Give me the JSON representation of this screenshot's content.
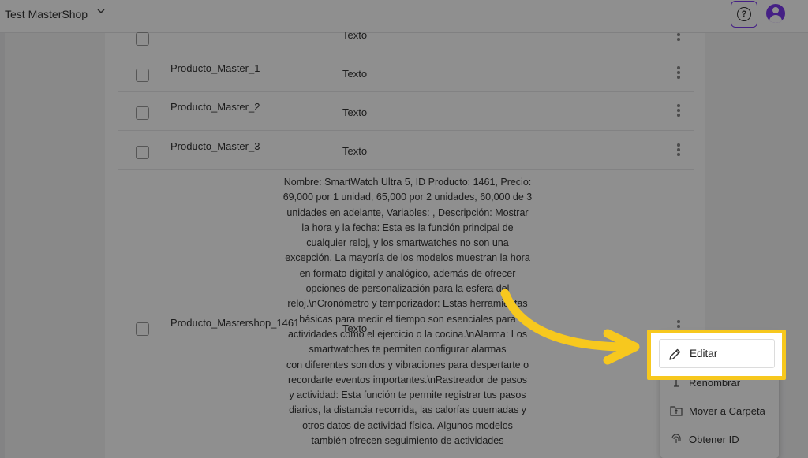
{
  "topbar": {
    "shop_name": "Test MasterShop",
    "chevron_glyph": "⌄",
    "help_glyph": "?"
  },
  "rows": [
    {
      "name": "",
      "type": "Texto"
    },
    {
      "name": "Producto_Master_1",
      "type": "Texto"
    },
    {
      "name": "Producto_Master_2",
      "type": "Texto"
    },
    {
      "name": "Producto_Master_3",
      "type": "Texto"
    },
    {
      "name": "Producto_Mastershop_1461",
      "type": "Texto"
    }
  ],
  "description_lines": [
    "Nombre: SmartWatch Ultra 5, ID Producto: 1461, Precio:",
    "69,000 por 1 unidad, 65,000 por 2 unidades, 60,000 de 3",
    "unidades en adelante, Variables: , Descripción: Mostrar",
    "la hora y la fecha: Esta es la función principal de",
    "cualquier reloj, y los smartwatches no son una",
    "excepción. La mayoría de los modelos muestran la hora",
    "en formato digital y analógico, además de ofrecer",
    "opciones de personalización para la esfera del",
    "reloj.\\nCronómetro y temporizador: Estas herramientas",
    "básicas para medir el tiempo son esenciales para",
    "actividades como el ejercicio o la cocina.\\nAlarma: Los",
    "smartwatches te permiten configurar alarmas",
    "con diferentes sonidos y vibraciones para despertarte o",
    "recordarte eventos importantes.\\nRastreador de pasos",
    "y actividad: Esta función te permite registrar tus pasos",
    "diarios, la distancia recorrida, las calorías quemadas y",
    "otros datos de actividad física. Algunos modelos",
    "también ofrecen seguimiento de actividades"
  ],
  "menu": {
    "items": [
      {
        "label": "Editar",
        "icon": "pencil-icon"
      },
      {
        "label": "Renombrar",
        "icon": "text-cursor-icon"
      },
      {
        "label": "Mover a Carpeta",
        "icon": "folder-move-icon"
      },
      {
        "label": "Obtener ID",
        "icon": "fingerprint-icon"
      }
    ]
  },
  "colors": {
    "accent": "#7c3aed",
    "highlight": "#f7c81e"
  }
}
